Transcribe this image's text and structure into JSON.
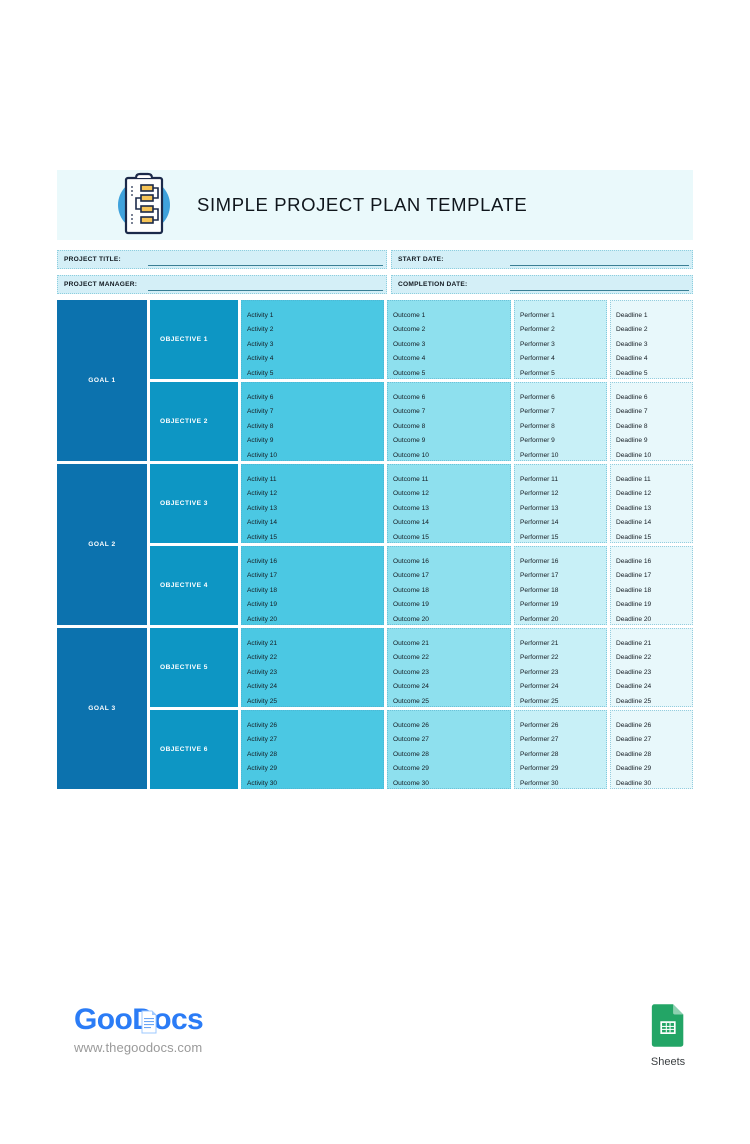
{
  "document": {
    "title": "SIMPLE PROJECT PLAN TEMPLATE",
    "header_icon": "clipboard-flowchart-icon",
    "header_bg": "#EAF9FB"
  },
  "meta": {
    "fields": [
      {
        "label": "PROJECT TITLE:",
        "value": ""
      },
      {
        "label": "START DATE:",
        "value": ""
      },
      {
        "label": "PROJECT MANAGER:",
        "value": ""
      },
      {
        "label": "COMPLETION DATE:",
        "value": ""
      }
    ]
  },
  "colors": {
    "goal": "#0C72AE",
    "objective": "#0D96C4",
    "activity": "#4BC8E3",
    "outcome": "#8EE0EE",
    "performer": "#C8F0F7",
    "deadline": "#E8F8FB",
    "banner": "#EAF9FB",
    "logo_blue": "#2B7CF6",
    "sheets_green": "#23A566"
  },
  "matrix": {
    "goals": [
      {
        "label": "GOAL 1",
        "objectives": [
          {
            "label": "OBJECTIVE 1",
            "activities": [
              "Activity 1",
              "Activity 2",
              "Activity 3",
              "Activity 4",
              "Activity 5"
            ],
            "outcomes": [
              "Outcome 1",
              "Outcome 2",
              "Outcome 3",
              "Outcome 4",
              "Outcome 5"
            ],
            "performers": [
              "Performer 1",
              "Performer 2",
              "Performer 3",
              "Performer 4",
              "Performer 5"
            ],
            "deadlines": [
              "Deadline 1",
              "Deadline 2",
              "Deadline 3",
              "Deadline 4",
              "Deadline 5"
            ]
          },
          {
            "label": "OBJECTIVE 2",
            "activities": [
              "Activity 6",
              "Activity 7",
              "Activity 8",
              "Activity 9",
              "Activity 10"
            ],
            "outcomes": [
              "Outcome 6",
              "Outcome 7",
              "Outcome 8",
              "Outcome 9",
              "Outcome 10"
            ],
            "performers": [
              "Performer 6",
              "Performer 7",
              "Performer 8",
              "Performer 9",
              "Performer 10"
            ],
            "deadlines": [
              "Deadline 6",
              "Deadline 7",
              "Deadline 8",
              "Deadline 9",
              "Deadline 10"
            ]
          }
        ]
      },
      {
        "label": "GOAL 2",
        "objectives": [
          {
            "label": "OBJECTIVE 3",
            "activities": [
              "Activity 11",
              "Activity 12",
              "Activity 13",
              "Activity 14",
              "Activity 15"
            ],
            "outcomes": [
              "Outcome 11",
              "Outcome 12",
              "Outcome 13",
              "Outcome 14",
              "Outcome 15"
            ],
            "performers": [
              "Performer 11",
              "Performer 12",
              "Performer 13",
              "Performer 14",
              "Performer 15"
            ],
            "deadlines": [
              "Deadline 11",
              "Deadline 12",
              "Deadline 13",
              "Deadline 14",
              "Deadline 15"
            ]
          },
          {
            "label": "OBJECTIVE 4",
            "activities": [
              "Activity 16",
              "Activity 17",
              "Activity 18",
              "Activity 19",
              "Activity 20"
            ],
            "outcomes": [
              "Outcome 16",
              "Outcome 17",
              "Outcome 18",
              "Outcome 19",
              "Outcome 20"
            ],
            "performers": [
              "Performer 16",
              "Performer 17",
              "Performer 18",
              "Performer 19",
              "Performer 20"
            ],
            "deadlines": [
              "Deadline 16",
              "Deadline 17",
              "Deadline 18",
              "Deadline 19",
              "Deadline 20"
            ]
          }
        ]
      },
      {
        "label": "GOAL 3",
        "objectives": [
          {
            "label": "OBJECTIVE 5",
            "activities": [
              "Activity 21",
              "Activity 22",
              "Activity 23",
              "Activity 24",
              "Activity 25"
            ],
            "outcomes": [
              "Outcome 21",
              "Outcome 22",
              "Outcome 23",
              "Outcome 24",
              "Outcome 25"
            ],
            "performers": [
              "Performer 21",
              "Performer 22",
              "Performer 23",
              "Performer 24",
              "Performer 25"
            ],
            "deadlines": [
              "Deadline 21",
              "Deadline 22",
              "Deadline 23",
              "Deadline 24",
              "Deadline 25"
            ]
          },
          {
            "label": "OBJECTIVE 6",
            "activities": [
              "Activity 26",
              "Activity 27",
              "Activity 28",
              "Activity 29",
              "Activity 30"
            ],
            "outcomes": [
              "Outcome 26",
              "Outcome 27",
              "Outcome 28",
              "Outcome 29",
              "Outcome 30"
            ],
            "performers": [
              "Performer 26",
              "Performer 27",
              "Performer 28",
              "Performer 29",
              "Performer 30"
            ],
            "deadlines": [
              "Deadline 26",
              "Deadline 27",
              "Deadline 28",
              "Deadline 29",
              "Deadline 30"
            ]
          }
        ]
      }
    ]
  },
  "footer": {
    "logo_part1": "Goo",
    "logo_part2": "Docs",
    "url": "www.thegoodocs.com",
    "product_label": "Sheets",
    "product_icon": "google-sheets-icon"
  }
}
